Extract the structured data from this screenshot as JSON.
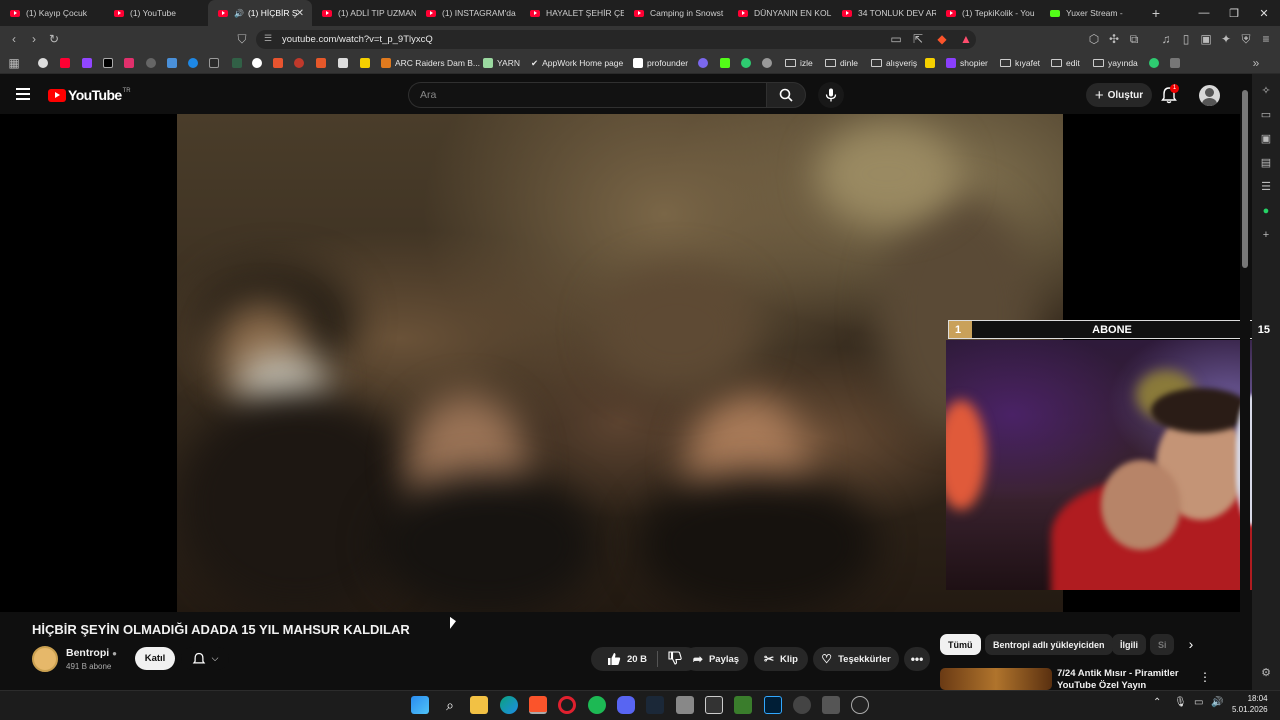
{
  "browser": {
    "tabs": [
      {
        "label": "(1) Kayıp Çocuk",
        "active": false
      },
      {
        "label": "(1) YouTube",
        "active": false
      },
      {
        "label": "(1) HİÇBİR Ş",
        "active": true
      },
      {
        "label": "(1) ADLİ TIP UZMAN",
        "active": false
      },
      {
        "label": "(1) INSTAGRAM'da",
        "active": false
      },
      {
        "label": "HAYALET ŞEHİR ÇEF",
        "active": false
      },
      {
        "label": "Camping in Snowst",
        "active": false
      },
      {
        "label": "DÜNYANIN EN KOL",
        "active": false
      },
      {
        "label": "34 TONLUK DEV AR",
        "active": false
      },
      {
        "label": "(1) TepkiKolik - You",
        "active": false
      },
      {
        "label": "Yuxer Stream -",
        "active": false
      }
    ],
    "url": "youtube.com/watch?v=t_p_9TlyxcQ",
    "bookmarks": [
      {
        "label": "ARC Raiders Dam B...",
        "color": "#e07a1e"
      },
      {
        "label": "YARN",
        "color": "#9bd9a0"
      },
      {
        "label": "AppWork Home page",
        "color": "#ffffff"
      },
      {
        "label": "profounder",
        "color": "#ffffff"
      },
      {
        "label": "izle",
        "color": ""
      },
      {
        "label": "dinle",
        "color": ""
      },
      {
        "label": "alışveriş",
        "color": ""
      },
      {
        "label": "shopier",
        "color": "#8a3ffc"
      },
      {
        "label": "kıyafet",
        "color": ""
      },
      {
        "label": "edit",
        "color": ""
      },
      {
        "label": "yayında",
        "color": ""
      }
    ]
  },
  "youtube": {
    "region": "TR",
    "search_placeholder": "Ara",
    "create_label": "Oluştur",
    "notification_count": "1",
    "video_title": "HİÇBİR ŞEYİN OLMADIĞI ADADA 15 YIL MAHSUR KALDILAR",
    "channel": {
      "name": "Bentropi",
      "subscribers": "491 B abone",
      "join_label": "Katıl"
    },
    "actions": {
      "likes": "20 B",
      "share": "Paylaş",
      "clip": "Klip",
      "thanks": "Teşekkürler"
    },
    "chips": [
      "Tümü",
      "Bentropi adlı yükleyiciden",
      "İlgili",
      "Si"
    ],
    "recommendation": {
      "title": "7/24 Antik Mısır - Piramitler YouTube Özel Yayın"
    },
    "overlay": {
      "left_number": "1",
      "label": "ABONE",
      "right_number": "15",
      "progress": 0.07
    }
  },
  "taskbar": {
    "time": "18:04",
    "date": "5.01.2026"
  },
  "colors": {
    "accent_red": "#ff0000",
    "bg": "#0f0f0f"
  }
}
